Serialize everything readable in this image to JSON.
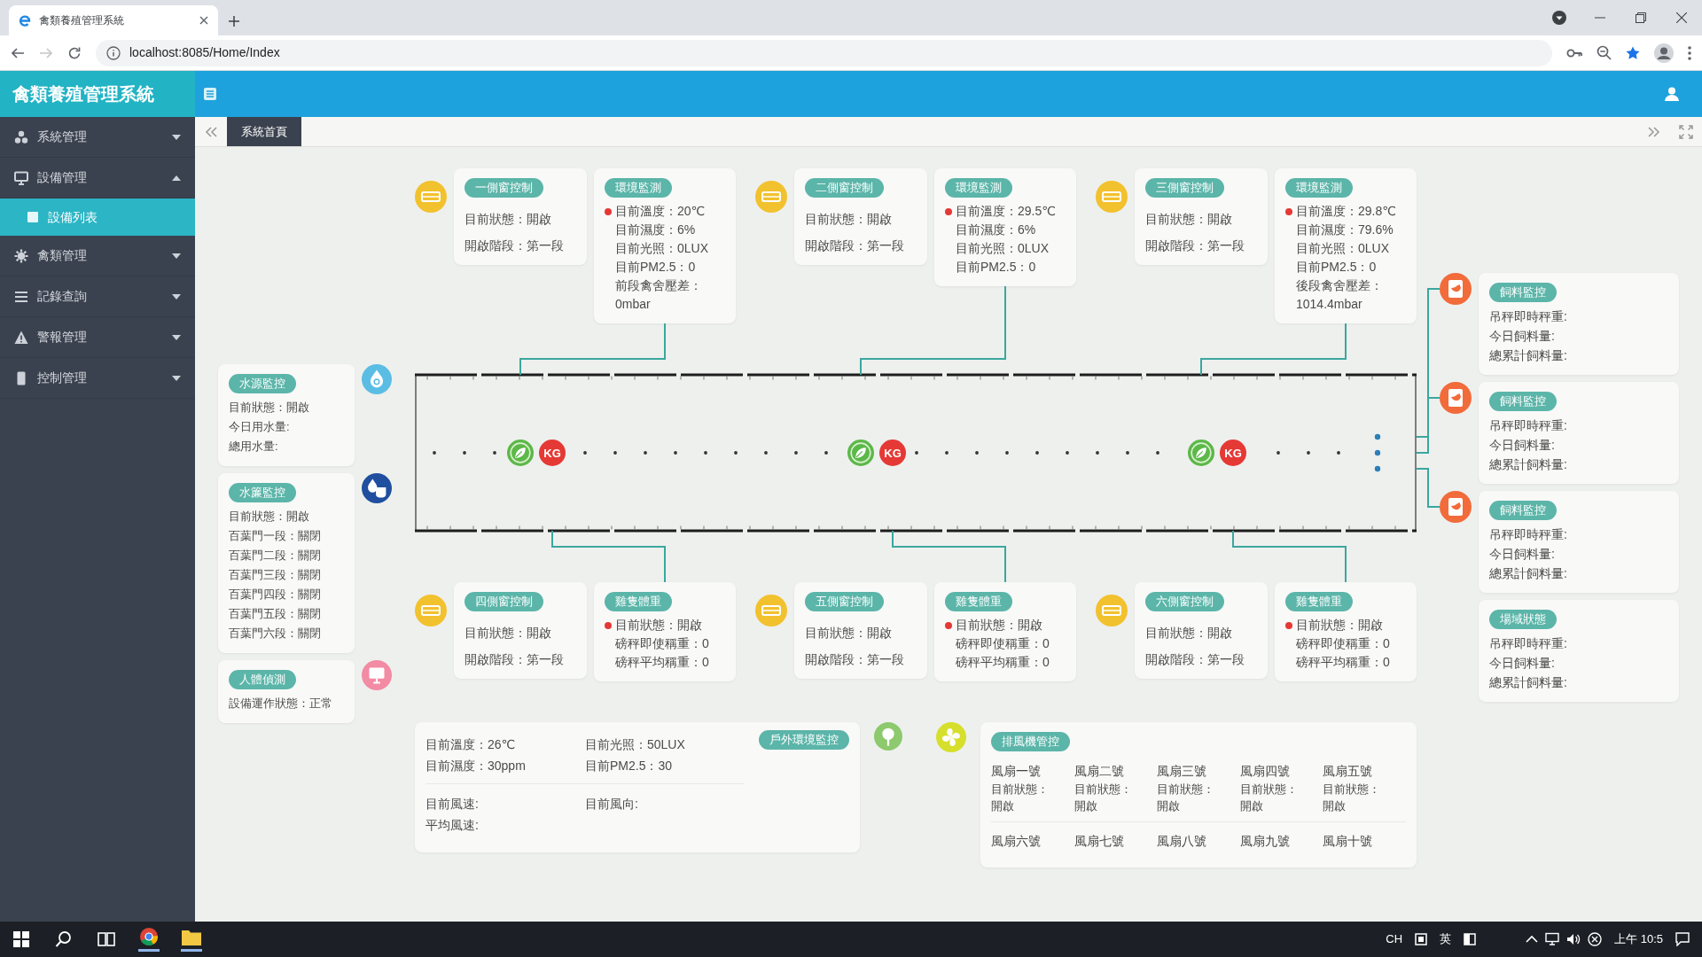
{
  "browser": {
    "tab_title": "禽類養殖管理系統",
    "url": "localhost:8085/Home/Index",
    "bookmarked": true
  },
  "app": {
    "title": "禽類養殖管理系統"
  },
  "sidebar": {
    "items": [
      {
        "label": "系統管理",
        "expanded": false
      },
      {
        "label": "設備管理",
        "expanded": true,
        "children": [
          {
            "label": "設備列表",
            "selected": true
          }
        ]
      },
      {
        "label": "禽類管理",
        "expanded": false
      },
      {
        "label": "記錄查詢",
        "expanded": false
      },
      {
        "label": "警報管理",
        "expanded": false
      },
      {
        "label": "控制管理",
        "expanded": false
      }
    ]
  },
  "page_tabs": [
    {
      "label": "系統首頁",
      "selected": true
    }
  ],
  "top_row": [
    {
      "control": {
        "title": "一側窗控制",
        "lines": [
          "目前狀態：開啟",
          "開啟階段：第一段"
        ]
      },
      "monitor": {
        "title": "環境監測",
        "alarm": true,
        "lines": [
          "目前溫度：20℃",
          "目前濕度：6%",
          "目前光照：0LUX",
          "目前PM2.5：0",
          "前段禽舍壓差：0mbar"
        ]
      }
    },
    {
      "control": {
        "title": "二側窗控制",
        "lines": [
          "目前狀態：開啟",
          "開啟階段：第一段"
        ]
      },
      "monitor": {
        "title": "環境監測",
        "alarm": true,
        "lines": [
          "目前溫度：29.5℃",
          "目前濕度：6%",
          "目前光照：0LUX",
          "目前PM2.5：0"
        ]
      }
    },
    {
      "control": {
        "title": "三側窗控制",
        "lines": [
          "目前狀態：開啟",
          "開啟階段：第一段"
        ]
      },
      "monitor": {
        "title": "環境監測",
        "alarm": true,
        "lines": [
          "目前溫度：29.8℃",
          "目前濕度：79.6%",
          "目前光照：0LUX",
          "目前PM2.5：0",
          "後段禽舍壓差：1014.4mbar"
        ]
      }
    }
  ],
  "left_panels": [
    {
      "title": "水源監控",
      "lines": [
        "目前狀態：開啟",
        "今日用水量:",
        "總用水量:"
      ]
    },
    {
      "title": "水簾監控",
      "lines": [
        "目前狀態：開啟",
        "百葉門一段：關閉",
        "百葉門二段：關閉",
        "百葉門三段：關閉",
        "百葉門四段：關閉",
        "百葉門五段：關閉",
        "百葉門六段：關閉"
      ]
    },
    {
      "title": "人體偵測",
      "lines": [
        "設備運作狀態：正常"
      ]
    }
  ],
  "house": {
    "scales": [
      {
        "label": "KG"
      },
      {
        "label": "KG"
      },
      {
        "label": "KG"
      }
    ]
  },
  "right_panels": [
    {
      "kind": "feed",
      "title": "飼料監控",
      "lines": [
        "吊秤即時秤重:",
        "今日飼料量:",
        "總累計飼料量:"
      ]
    },
    {
      "kind": "feed",
      "title": "飼料監控",
      "lines": [
        "吊秤即時秤重:",
        "今日飼料量:",
        "總累計飼料量:"
      ]
    },
    {
      "kind": "feed",
      "title": "飼料監控",
      "lines": [
        "吊秤即時秤重:",
        "今日飼料量:",
        "總累計飼料量:"
      ]
    },
    {
      "kind": "field",
      "title": "場域狀態",
      "lines": [
        "吊秤即時秤重:",
        "今日飼料量:",
        "總累計飼料量:"
      ]
    }
  ],
  "bottom_row": [
    {
      "control": {
        "title": "四側窗控制",
        "lines": [
          "目前狀態：開啟",
          "開啟階段：第一段"
        ]
      },
      "monitor": {
        "title": "雞隻體重",
        "alarm": true,
        "lines": [
          "目前狀態：開啟",
          "磅秤即使稱重：0",
          "磅秤平均稱重：0"
        ]
      }
    },
    {
      "control": {
        "title": "五側窗控制",
        "lines": [
          "目前狀態：開啟",
          "開啟階段：第一段"
        ]
      },
      "monitor": {
        "title": "雞隻體重",
        "alarm": true,
        "lines": [
          "目前狀態：開啟",
          "磅秤即使稱重：0",
          "磅秤平均稱重：0"
        ]
      }
    },
    {
      "control": {
        "title": "六側窗控制",
        "lines": [
          "目前狀態：開啟",
          "開啟階段：第一段"
        ]
      },
      "monitor": {
        "title": "雞隻體重",
        "alarm": true,
        "lines": [
          "目前狀態：開啟",
          "磅秤即使稱重：0",
          "磅秤平均稱重：0"
        ]
      }
    }
  ],
  "outdoor": {
    "title": "戶外環境監控",
    "blocks": [
      {
        "columns": [
          [
            "目前溫度：26℃",
            "目前濕度：30ppm"
          ],
          [
            "目前光照：50LUX",
            "目前PM2.5：30"
          ]
        ]
      },
      {
        "columns": [
          [
            "目前風速:",
            "平均風速:"
          ],
          [
            "目前風向:"
          ]
        ]
      }
    ]
  },
  "fans": {
    "title": "排風機管控",
    "items": [
      {
        "name": "風扇一號",
        "status_label": "目前狀態：",
        "status": "開啟"
      },
      {
        "name": "風扇二號",
        "status_label": "目前狀態：",
        "status": "開啟"
      },
      {
        "name": "風扇三號",
        "status_label": "目前狀態：",
        "status": "開啟"
      },
      {
        "name": "風扇四號",
        "status_label": "目前狀態：",
        "status": "開啟"
      },
      {
        "name": "風扇五號",
        "status_label": "目前狀態：",
        "status": "開啟"
      },
      {
        "name": "風扇六號"
      },
      {
        "name": "風扇七號"
      },
      {
        "name": "風扇八號"
      },
      {
        "name": "風扇九號"
      },
      {
        "name": "風扇十號"
      }
    ]
  },
  "taskbar": {
    "ime": "CH",
    "language": "英",
    "time": "上午 10:5"
  }
}
